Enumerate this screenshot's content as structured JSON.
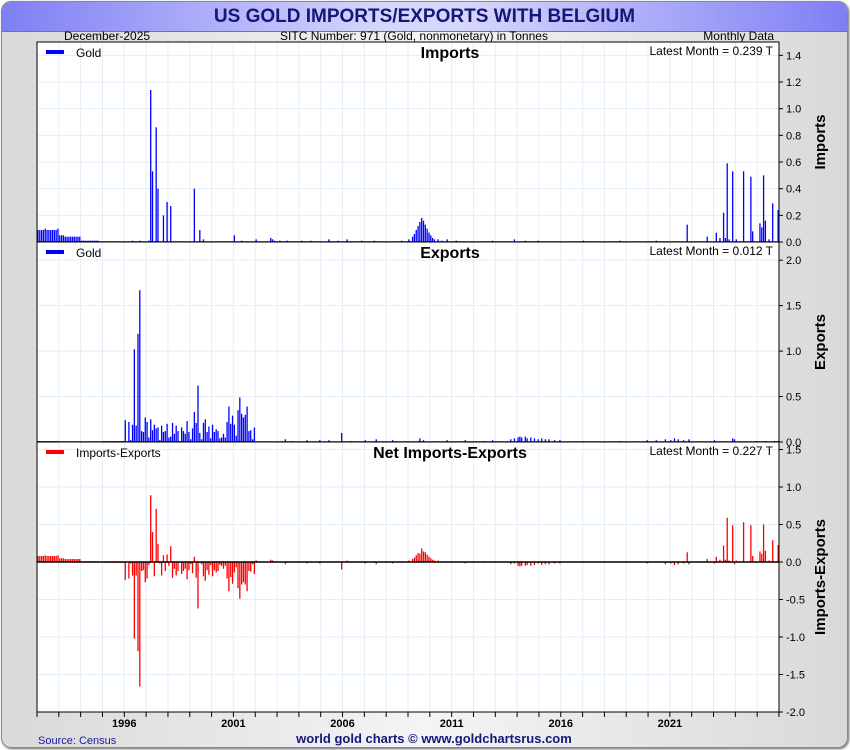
{
  "title": "US GOLD IMPORTS/EXPORTS WITH BELGIUM",
  "header": {
    "date": "December-2025",
    "sitc": "SITC Number: 971 (Gold, nonmonetary) in Tonnes",
    "frequency": "Monthly Data"
  },
  "footer": {
    "source": "Source: Census",
    "credit": "world gold charts © www.goldchartsrus.com"
  },
  "colors": {
    "imports": "#0000ff",
    "exports": "#0000ff",
    "net": "#ff0000",
    "title_text": "#16167a",
    "grid": "#e3eef8"
  },
  "chart_data": [
    {
      "type": "bar",
      "name": "imports",
      "title": "Imports",
      "ylabel": "Imports",
      "legend": "Gold",
      "legend_position": "top-left",
      "annotation": "Latest Month = 0.239 T",
      "ylim": [
        0,
        1.5
      ],
      "yticks": [
        "0.0",
        "0.2",
        "0.4",
        "0.6",
        "0.8",
        "1.0",
        "1.2",
        "1.4"
      ],
      "ytick_values": [
        0,
        0.2,
        0.4,
        0.6,
        0.8,
        1.0,
        1.2,
        1.4
      ],
      "start_month": "1992-01",
      "months": 408,
      "points": [
        [
          0,
          0.09
        ],
        [
          1,
          0.09
        ],
        [
          2,
          0.09
        ],
        [
          3,
          0.09
        ],
        [
          4,
          0.1
        ],
        [
          5,
          0.09
        ],
        [
          6,
          0.09
        ],
        [
          7,
          0.09
        ],
        [
          8,
          0.09
        ],
        [
          9,
          0.09
        ],
        [
          10,
          0.09
        ],
        [
          11,
          0.1
        ],
        [
          12,
          0.05
        ],
        [
          13,
          0.05
        ],
        [
          14,
          0.05
        ],
        [
          15,
          0.04
        ],
        [
          16,
          0.04
        ],
        [
          17,
          0.04
        ],
        [
          18,
          0.04
        ],
        [
          19,
          0.04
        ],
        [
          20,
          0.04
        ],
        [
          21,
          0.04
        ],
        [
          22,
          0.04
        ],
        [
          23,
          0.04
        ],
        [
          24,
          0.01
        ],
        [
          25,
          0.01
        ],
        [
          26,
          0.01
        ],
        [
          27,
          0.01
        ],
        [
          28,
          0.01
        ],
        [
          29,
          0.01
        ],
        [
          30,
          0.01
        ],
        [
          31,
          0.01
        ],
        [
          32,
          0.01
        ],
        [
          33,
          0.01
        ],
        [
          52,
          0.01
        ],
        [
          56,
          0.01
        ],
        [
          61,
          0.01
        ],
        [
          62,
          1.14
        ],
        [
          63,
          0.53
        ],
        [
          65,
          0.86
        ],
        [
          66,
          0.4
        ],
        [
          69,
          0.2
        ],
        [
          71,
          0.3
        ],
        [
          73,
          0.27
        ],
        [
          86,
          0.4
        ],
        [
          89,
          0.09
        ],
        [
          91,
          0.02
        ],
        [
          108,
          0.05
        ],
        [
          112,
          0.01
        ],
        [
          120,
          0.02
        ],
        [
          128,
          0.03
        ],
        [
          129,
          0.02
        ],
        [
          130,
          0.01
        ],
        [
          133,
          0.01
        ],
        [
          137,
          0.01
        ],
        [
          145,
          0.01
        ],
        [
          150,
          0.01
        ],
        [
          160,
          0.02
        ],
        [
          165,
          0.01
        ],
        [
          170,
          0.02
        ],
        [
          178,
          0.01
        ],
        [
          185,
          0.01
        ],
        [
          200,
          0.01
        ],
        [
          204,
          0.02
        ],
        [
          206,
          0.04
        ],
        [
          207,
          0.06
        ],
        [
          208,
          0.09
        ],
        [
          209,
          0.12
        ],
        [
          210,
          0.15
        ],
        [
          211,
          0.18
        ],
        [
          212,
          0.16
        ],
        [
          213,
          0.13
        ],
        [
          214,
          0.1
        ],
        [
          215,
          0.07
        ],
        [
          216,
          0.05
        ],
        [
          217,
          0.03
        ],
        [
          218,
          0.02
        ],
        [
          220,
          0.02
        ],
        [
          222,
          0.01
        ],
        [
          225,
          0.02
        ],
        [
          230,
          0.01
        ],
        [
          250,
          0.01
        ],
        [
          262,
          0.02
        ],
        [
          268,
          0.01
        ],
        [
          275,
          0.01
        ],
        [
          300,
          0.01
        ],
        [
          320,
          0.01
        ],
        [
          340,
          0.01
        ],
        [
          357,
          0.13
        ],
        [
          368,
          0.04
        ],
        [
          373,
          0.07
        ],
        [
          375,
          0.03
        ],
        [
          377,
          0.22
        ],
        [
          378,
          0.03
        ],
        [
          379,
          0.59
        ],
        [
          380,
          0.02
        ],
        [
          382,
          0.53
        ],
        [
          384,
          0.02
        ],
        [
          388,
          0.53
        ],
        [
          392,
          0.49
        ],
        [
          393,
          0.08
        ],
        [
          397,
          0.14
        ],
        [
          398,
          0.11
        ],
        [
          399,
          0.5
        ],
        [
          400,
          0.16
        ],
        [
          402,
          0.02
        ],
        [
          404,
          0.29
        ],
        [
          407,
          0.239
        ]
      ]
    },
    {
      "type": "bar",
      "name": "exports",
      "title": "Exports",
      "ylabel": "Exports",
      "legend": "Gold",
      "legend_position": "top-left",
      "annotation": "Latest Month = 0.012 T",
      "ylim": [
        0,
        2.2
      ],
      "yticks": [
        "0.0",
        "0.5",
        "1.0",
        "1.5",
        "2.0"
      ],
      "ytick_values": [
        0,
        0.5,
        1.0,
        1.5,
        2.0
      ],
      "start_month": "1992-01",
      "months": 408,
      "points": [
        [
          0,
          0.01
        ],
        [
          1,
          0.01
        ],
        [
          2,
          0.01
        ],
        [
          3,
          0.01
        ],
        [
          4,
          0.01
        ],
        [
          5,
          0.01
        ],
        [
          6,
          0.01
        ],
        [
          7,
          0.01
        ],
        [
          8,
          0.01
        ],
        [
          9,
          0.01
        ],
        [
          10,
          0.01
        ],
        [
          11,
          0.01
        ],
        [
          36,
          0.01
        ],
        [
          37,
          0.01
        ],
        [
          38,
          0.01
        ],
        [
          39,
          0.01
        ],
        [
          40,
          0.01
        ],
        [
          41,
          0.01
        ],
        [
          42,
          0.01
        ],
        [
          43,
          0.01
        ],
        [
          44,
          0.01
        ],
        [
          45,
          0.01
        ],
        [
          46,
          0.01
        ],
        [
          47,
          0.01
        ],
        [
          48,
          0.24
        ],
        [
          50,
          0.22
        ],
        [
          51,
          0.02
        ],
        [
          52,
          0.19
        ],
        [
          53,
          1.02
        ],
        [
          54,
          0.18
        ],
        [
          55,
          1.19
        ],
        [
          56,
          1.67
        ],
        [
          57,
          0.12
        ],
        [
          58,
          0.11
        ],
        [
          59,
          0.27
        ],
        [
          60,
          0.22
        ],
        [
          61,
          0.05
        ],
        [
          62,
          0.25
        ],
        [
          63,
          0.13
        ],
        [
          64,
          0.19
        ],
        [
          65,
          0.15
        ],
        [
          66,
          0.16
        ],
        [
          67,
          0.02
        ],
        [
          68,
          0.18
        ],
        [
          69,
          0.11
        ],
        [
          70,
          0.12
        ],
        [
          71,
          0.2
        ],
        [
          72,
          0.05
        ],
        [
          73,
          0.06
        ],
        [
          74,
          0.21
        ],
        [
          75,
          0.09
        ],
        [
          76,
          0.18
        ],
        [
          77,
          0.12
        ],
        [
          78,
          0.01
        ],
        [
          79,
          0.16
        ],
        [
          80,
          0.12
        ],
        [
          81,
          0.09
        ],
        [
          82,
          0.23
        ],
        [
          83,
          0.11
        ],
        [
          84,
          0.03
        ],
        [
          85,
          0.15
        ],
        [
          86,
          0.33
        ],
        [
          87,
          0.21
        ],
        [
          88,
          0.62
        ],
        [
          89,
          0.1
        ],
        [
          90,
          0.03
        ],
        [
          91,
          0.21
        ],
        [
          92,
          0.25
        ],
        [
          93,
          0.11
        ],
        [
          94,
          0.17
        ],
        [
          95,
          0.04
        ],
        [
          96,
          0.19
        ],
        [
          97,
          0.11
        ],
        [
          98,
          0.14
        ],
        [
          99,
          0.12
        ],
        [
          100,
          0.04
        ],
        [
          101,
          0.05
        ],
        [
          102,
          0.09
        ],
        [
          103,
          0.05
        ],
        [
          104,
          0.22
        ],
        [
          105,
          0.39
        ],
        [
          106,
          0.2
        ],
        [
          107,
          0.29
        ],
        [
          108,
          0.19
        ],
        [
          109,
          0.07
        ],
        [
          110,
          0.35
        ],
        [
          111,
          0.49
        ],
        [
          112,
          0.31
        ],
        [
          113,
          0.27
        ],
        [
          114,
          0.3
        ],
        [
          115,
          0.39
        ],
        [
          116,
          0.12
        ],
        [
          117,
          0.13
        ],
        [
          118,
          0.03
        ],
        [
          119,
          0.16
        ],
        [
          136,
          0.03
        ],
        [
          140,
          0.01
        ],
        [
          148,
          0.02
        ],
        [
          155,
          0.02
        ],
        [
          160,
          0.02
        ],
        [
          167,
          0.1
        ],
        [
          172,
          0.01
        ],
        [
          180,
          0.02
        ],
        [
          186,
          0.03
        ],
        [
          195,
          0.02
        ],
        [
          210,
          0.04
        ],
        [
          212,
          0.02
        ],
        [
          225,
          0.02
        ],
        [
          235,
          0.02
        ],
        [
          245,
          0.01
        ],
        [
          250,
          0.02
        ],
        [
          260,
          0.03
        ],
        [
          262,
          0.04
        ],
        [
          264,
          0.05
        ],
        [
          265,
          0.06
        ],
        [
          266,
          0.05
        ],
        [
          268,
          0.06
        ],
        [
          269,
          0.04
        ],
        [
          271,
          0.05
        ],
        [
          273,
          0.04
        ],
        [
          275,
          0.03
        ],
        [
          277,
          0.04
        ],
        [
          279,
          0.03
        ],
        [
          281,
          0.03
        ],
        [
          284,
          0.02
        ],
        [
          287,
          0.02
        ],
        [
          300,
          0.01
        ],
        [
          320,
          0.01
        ],
        [
          335,
          0.02
        ],
        [
          340,
          0.02
        ],
        [
          345,
          0.03
        ],
        [
          348,
          0.02
        ],
        [
          350,
          0.04
        ],
        [
          352,
          0.03
        ],
        [
          355,
          0.02
        ],
        [
          358,
          0.03
        ],
        [
          372,
          0.02
        ],
        [
          382,
          0.04
        ],
        [
          383,
          0.03
        ],
        [
          395,
          0.01
        ],
        [
          400,
          0.01
        ],
        [
          405,
          0.01
        ],
        [
          407,
          0.012
        ]
      ]
    },
    {
      "type": "bar",
      "name": "net",
      "title": "Net Imports-Exports",
      "ylabel": "Imports-Exports",
      "legend": "Imports-Exports",
      "legend_position": "top-left",
      "annotation": "Latest Month = 0.227 T",
      "definition": "imports minus exports",
      "ylim": [
        -2.0,
        1.6
      ],
      "yticks": [
        "1.5",
        "1.0",
        "0.5",
        "0.0",
        "-0.5",
        "-1.0",
        "-1.5",
        "-2.0"
      ],
      "ytick_values": [
        1.5,
        1.0,
        0.5,
        0,
        -0.5,
        -1.0,
        -1.5,
        -2.0
      ]
    }
  ],
  "xaxis": {
    "ticks": [
      "1996",
      "2001",
      "2006",
      "2011",
      "2016",
      "2021"
    ],
    "tick_years": [
      1996,
      2001,
      2006,
      2011,
      2016,
      2021
    ],
    "start_year": 1992,
    "end_year": 2026
  }
}
